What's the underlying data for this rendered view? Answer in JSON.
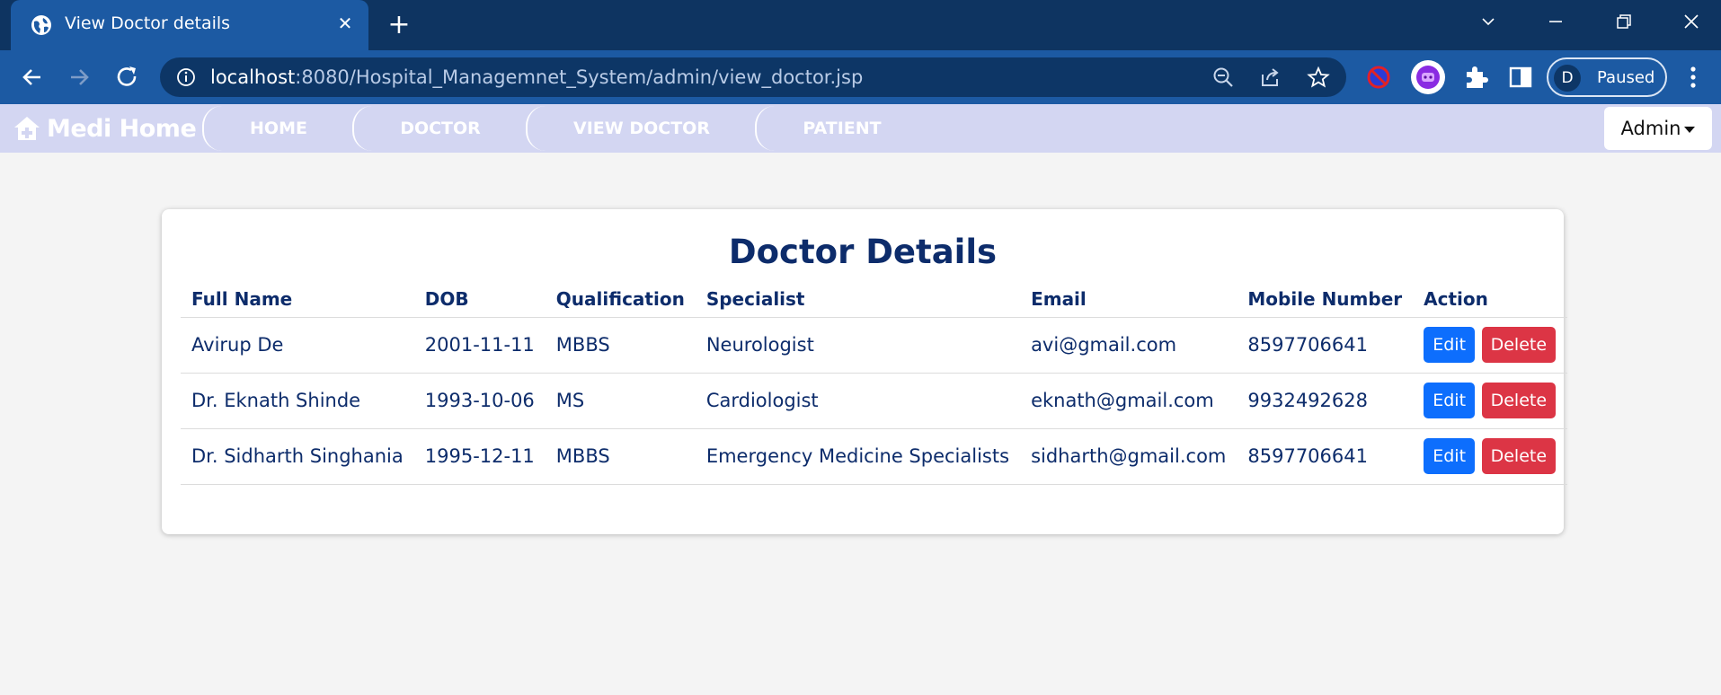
{
  "browser": {
    "tab_title": "View Doctor details",
    "url_host": "localhost",
    "url_rest": ":8080/Hospital_Managemnet_System/admin/view_doctor.jsp",
    "profile_initial": "D",
    "profile_status": "Paused"
  },
  "navbar": {
    "brand": "Medi Home",
    "items": [
      {
        "label": "HOME"
      },
      {
        "label": "DOCTOR"
      },
      {
        "label": "VIEW DOCTOR"
      },
      {
        "label": "PATIENT"
      }
    ],
    "admin_label": "Admin"
  },
  "card": {
    "title": "Doctor Details",
    "columns": [
      "Full Name",
      "DOB",
      "Qualification",
      "Specialist",
      "Email",
      "Mobile Number",
      "Action"
    ],
    "rows": [
      {
        "name": "Avirup De",
        "dob": "2001-11-11",
        "qualification": "MBBS",
        "specialist": "Neurologist",
        "email": "avi@gmail.com",
        "mobile": "8597706641"
      },
      {
        "name": "Dr. Eknath Shinde",
        "dob": "1993-10-06",
        "qualification": "MS",
        "specialist": "Cardiologist",
        "email": "eknath@gmail.com",
        "mobile": "9932492628"
      },
      {
        "name": "Dr. Sidharth Singhania",
        "dob": "1995-12-11",
        "qualification": "MBBS",
        "specialist": "Emergency Medicine Specialists",
        "email": "sidharth@gmail.com",
        "mobile": "8597706641"
      }
    ],
    "edit_label": "Edit",
    "delete_label": "Delete"
  },
  "colors": {
    "accent_navy": "#0d2c6b",
    "navbar_bg": "#d3d6f2",
    "edit": "#0d6efd",
    "delete": "#dc3545"
  }
}
